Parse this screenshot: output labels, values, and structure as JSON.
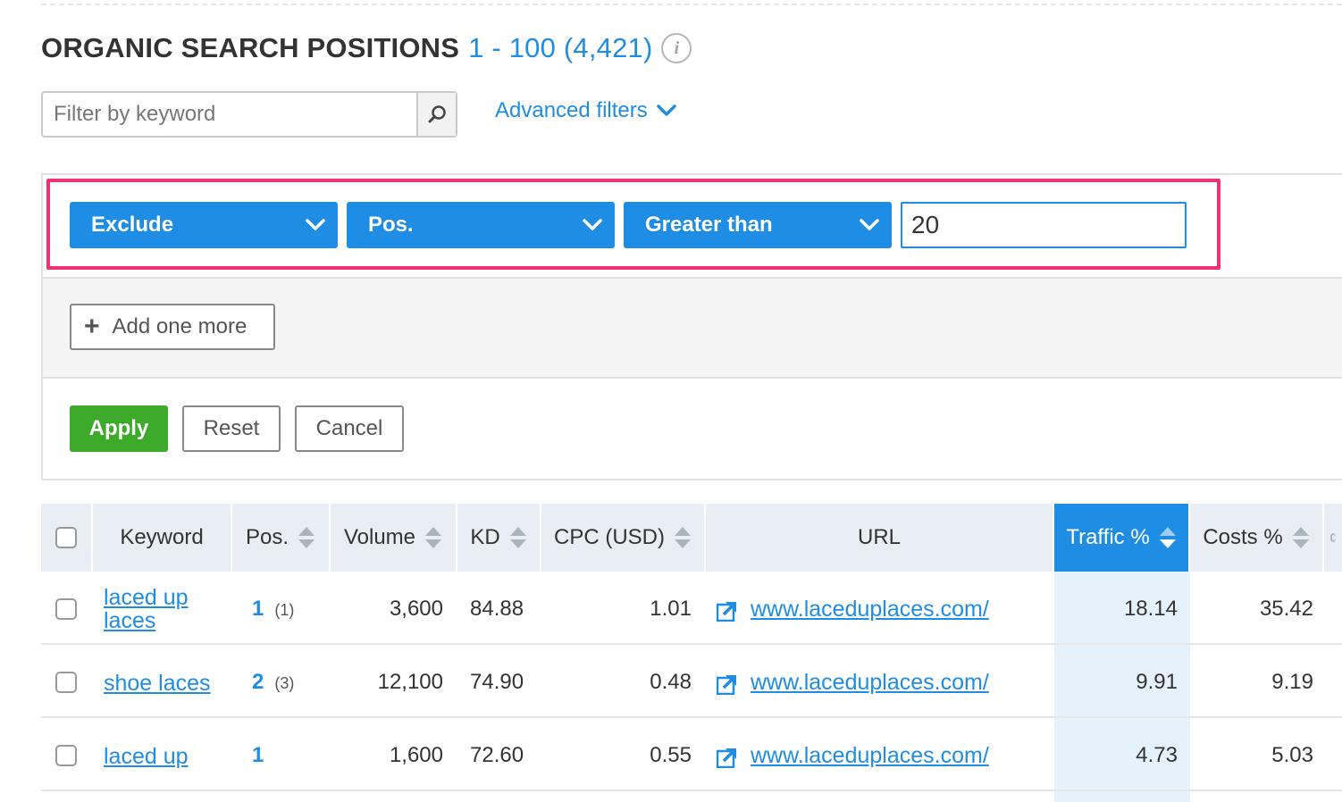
{
  "header": {
    "title": "ORGANIC SEARCH POSITIONS",
    "range": "1 - 100 (4,421)",
    "info_icon": "info-icon"
  },
  "search": {
    "placeholder": "Filter by keyword",
    "value": "",
    "icon": "search-icon"
  },
  "advanced_filters": {
    "label": "Advanced filters",
    "icon": "chevron-down-icon"
  },
  "filter": {
    "mode": "Exclude",
    "field": "Pos.",
    "operator": "Greater than",
    "value": "20"
  },
  "buttons": {
    "add_more": "Add one more",
    "apply": "Apply",
    "reset": "Reset",
    "cancel": "Cancel"
  },
  "colors": {
    "accent": "#1f8de3",
    "apply": "#3eaa2b",
    "highlight": "#f0336e"
  },
  "table": {
    "columns": [
      "Keyword",
      "Pos.",
      "Volume",
      "KD",
      "CPC (USD)",
      "URL",
      "Traffic %",
      "Costs %"
    ],
    "sorted_column": "Traffic %",
    "rows": [
      {
        "keyword": "laced up laces",
        "keyword_line1": "laced up",
        "keyword_line2": "laces",
        "pos": "1",
        "prev_pos": "(1)",
        "volume": "3,600",
        "kd": "84.88",
        "cpc": "1.01",
        "url": "www.laceduplaces.com/",
        "traffic": "18.14",
        "costs": "35.42"
      },
      {
        "keyword": "shoe laces",
        "pos": "2",
        "prev_pos": "(3)",
        "volume": "12,100",
        "kd": "74.90",
        "cpc": "0.48",
        "url": "www.laceduplaces.com/",
        "traffic": "9.91",
        "costs": "9.19"
      },
      {
        "keyword": "laced up",
        "pos": "1",
        "prev_pos": "",
        "volume": "1,600",
        "kd": "72.60",
        "cpc": "0.55",
        "url": "www.laceduplaces.com/",
        "traffic": "4.73",
        "costs": "5.03"
      }
    ]
  }
}
